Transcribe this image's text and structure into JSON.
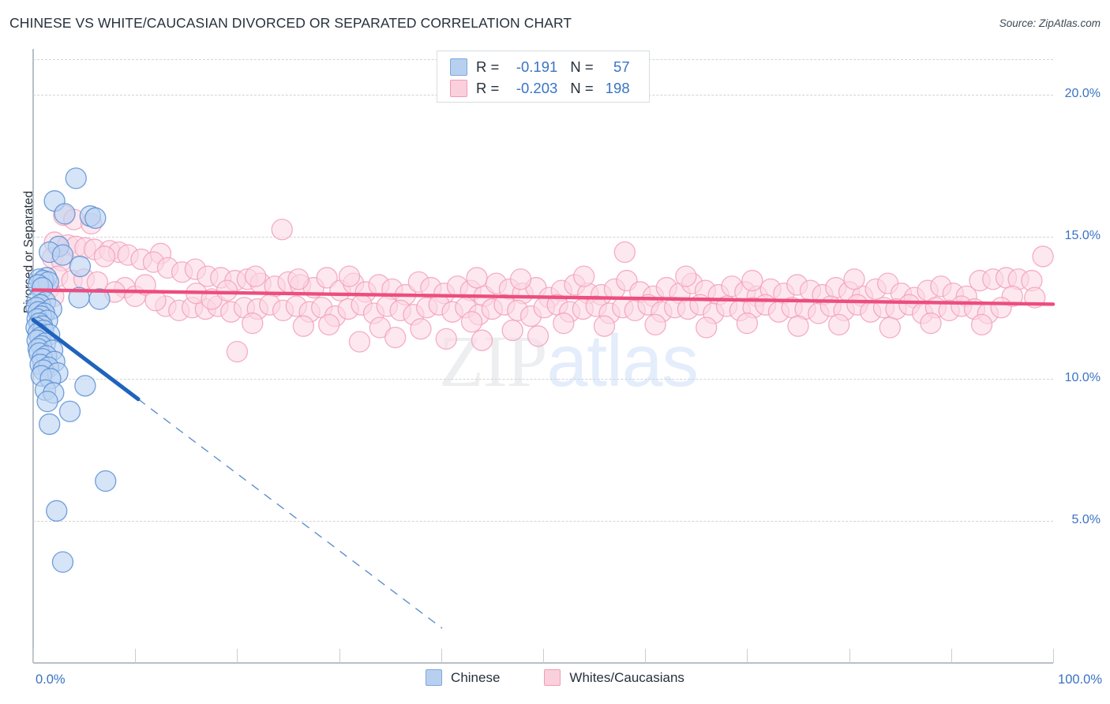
{
  "header": {
    "title": "CHINESE VS WHITE/CAUCASIAN DIVORCED OR SEPARATED CORRELATION CHART",
    "source": "Source: ZipAtlas.com"
  },
  "watermark": {
    "part1": "ZIP",
    "part2": "atlas"
  },
  "correlation_legend": {
    "rows": [
      {
        "color": "#b8d0ef",
        "r_label": "R = ",
        "r_value": "-0.191",
        "n_label": "N = ",
        "n_value": "57"
      },
      {
        "color": "#fbd0dd",
        "r_label": "R = ",
        "r_value": "-0.203",
        "n_label": "N = ",
        "n_value": "198"
      }
    ]
  },
  "series_legend": {
    "items": [
      {
        "label": "Chinese",
        "color": "#b8d0ef"
      },
      {
        "label": "Whites/Caucasians",
        "color": "#fbd0dd"
      }
    ]
  },
  "axes": {
    "y_title": "Divorced or Separated",
    "y_ticks": [
      "20.0%",
      "15.0%",
      "10.0%",
      "5.0%"
    ],
    "x_min_label": "0.0%",
    "x_max_label": "100.0%"
  },
  "colors": {
    "blue_fill": "#bcd4f2",
    "blue_stroke": "#5b8fd4",
    "pink_fill": "#fcd8e3",
    "pink_stroke": "#f3a0ba",
    "blue_trend": "#1f63bd",
    "pink_trend": "#ed4d7f",
    "tick_text": "#3973c4",
    "title_text": "#26313c"
  },
  "chart_data": {
    "type": "scatter",
    "title": "CHINESE VS WHITE/CAUCASIAN DIVORCED OR SEPARATED CORRELATION CHART",
    "xlabel": "",
    "ylabel": "Divorced or Separated",
    "xlim": [
      0,
      100
    ],
    "ylim": [
      0,
      21.6
    ],
    "x_tick_values": [
      0,
      10,
      20,
      30,
      40,
      50,
      60,
      70,
      80,
      90,
      100
    ],
    "y_tick_values": [
      5,
      10,
      15,
      20
    ],
    "y_tick_labels": [
      "5.0%",
      "10.0%",
      "15.0%",
      "20.0%"
    ],
    "x_axis_unit": "percent",
    "grid": "horizontal-dashed",
    "legend_position": "bottom-center",
    "series": [
      {
        "name": "Chinese",
        "color": "#bcd4f2",
        "R": -0.191,
        "N": 57,
        "trendline": {
          "type": "linear",
          "solid_from": [
            0.0,
            12.07
          ],
          "solid_to": [
            10.3,
            9.28
          ],
          "dashed_to": [
            40.1,
            1.22
          ]
        },
        "points": [
          [
            4.2,
            17.05
          ],
          [
            2.1,
            16.25
          ],
          [
            3.1,
            15.8
          ],
          [
            5.6,
            15.72
          ],
          [
            6.1,
            15.65
          ],
          [
            2.5,
            14.65
          ],
          [
            1.6,
            14.45
          ],
          [
            2.9,
            14.35
          ],
          [
            4.6,
            13.95
          ],
          [
            1.3,
            13.55
          ],
          [
            0.6,
            13.5
          ],
          [
            1.0,
            13.45
          ],
          [
            1.5,
            13.4
          ],
          [
            0.5,
            13.3
          ],
          [
            0.9,
            13.2
          ],
          [
            4.5,
            12.85
          ],
          [
            6.5,
            12.8
          ],
          [
            0.4,
            12.75
          ],
          [
            1.2,
            12.7
          ],
          [
            0.7,
            12.6
          ],
          [
            0.3,
            12.5
          ],
          [
            1.8,
            12.45
          ],
          [
            0.5,
            12.35
          ],
          [
            1.1,
            12.3
          ],
          [
            0.8,
            12.2
          ],
          [
            0.4,
            12.1
          ],
          [
            1.4,
            12.05
          ],
          [
            0.6,
            11.95
          ],
          [
            0.9,
            11.85
          ],
          [
            0.3,
            11.8
          ],
          [
            1.0,
            11.7
          ],
          [
            0.5,
            11.6
          ],
          [
            1.6,
            11.55
          ],
          [
            0.7,
            11.45
          ],
          [
            0.4,
            11.35
          ],
          [
            1.2,
            11.25
          ],
          [
            0.8,
            11.15
          ],
          [
            0.5,
            11.05
          ],
          [
            1.9,
            11.0
          ],
          [
            0.6,
            10.9
          ],
          [
            1.3,
            10.8
          ],
          [
            0.9,
            10.7
          ],
          [
            2.1,
            10.6
          ],
          [
            0.7,
            10.5
          ],
          [
            1.5,
            10.4
          ],
          [
            1.0,
            10.3
          ],
          [
            2.4,
            10.2
          ],
          [
            0.8,
            10.1
          ],
          [
            1.7,
            10.0
          ],
          [
            5.1,
            9.75
          ],
          [
            1.2,
            9.6
          ],
          [
            2.0,
            9.5
          ],
          [
            1.4,
            9.2
          ],
          [
            3.6,
            8.85
          ],
          [
            1.6,
            8.4
          ],
          [
            7.1,
            6.4
          ],
          [
            2.3,
            5.35
          ],
          [
            2.9,
            3.55
          ]
        ]
      },
      {
        "name": "Whites/Caucasians",
        "color": "#fcd8e3",
        "R": -0.203,
        "N": 198,
        "trendline": {
          "type": "linear",
          "from": [
            0.0,
            13.12
          ],
          "to": [
            100.0,
            12.62
          ]
        },
        "points": [
          [
            3.0,
            15.75
          ],
          [
            4.0,
            15.6
          ],
          [
            5.7,
            15.45
          ],
          [
            2.1,
            14.8
          ],
          [
            3.4,
            14.7
          ],
          [
            4.2,
            14.65
          ],
          [
            5.1,
            14.6
          ],
          [
            6.0,
            14.55
          ],
          [
            7.5,
            14.5
          ],
          [
            8.4,
            14.45
          ],
          [
            1.9,
            14.25
          ],
          [
            2.8,
            14.15
          ],
          [
            12.5,
            14.4
          ],
          [
            7.0,
            14.3
          ],
          [
            9.3,
            14.35
          ],
          [
            10.6,
            14.2
          ],
          [
            11.8,
            14.1
          ],
          [
            24.4,
            15.25
          ],
          [
            13.2,
            13.9
          ],
          [
            14.6,
            13.75
          ],
          [
            15.9,
            13.85
          ],
          [
            17.1,
            13.6
          ],
          [
            18.4,
            13.55
          ],
          [
            19.8,
            13.45
          ],
          [
            21.0,
            13.5
          ],
          [
            22.3,
            13.35
          ],
          [
            23.7,
            13.25
          ],
          [
            25.0,
            13.4
          ],
          [
            26.2,
            13.3
          ],
          [
            27.5,
            13.2
          ],
          [
            28.8,
            13.55
          ],
          [
            30.1,
            13.1
          ],
          [
            31.4,
            13.35
          ],
          [
            32.6,
            13.05
          ],
          [
            33.9,
            13.3
          ],
          [
            35.2,
            13.15
          ],
          [
            36.5,
            12.95
          ],
          [
            37.8,
            13.4
          ],
          [
            39.0,
            13.2
          ],
          [
            40.3,
            13.0
          ],
          [
            41.6,
            13.25
          ],
          [
            42.9,
            13.1
          ],
          [
            44.2,
            12.9
          ],
          [
            45.4,
            13.35
          ],
          [
            46.7,
            13.15
          ],
          [
            48.0,
            13.0
          ],
          [
            49.3,
            13.2
          ],
          [
            50.6,
            12.85
          ],
          [
            51.8,
            13.1
          ],
          [
            53.1,
            13.3
          ],
          [
            54.4,
            13.0
          ],
          [
            55.7,
            12.95
          ],
          [
            57.0,
            13.15
          ],
          [
            58.2,
            13.45
          ],
          [
            59.5,
            13.05
          ],
          [
            60.8,
            12.9
          ],
          [
            62.1,
            13.2
          ],
          [
            63.4,
            13.0
          ],
          [
            64.6,
            13.35
          ],
          [
            65.9,
            13.1
          ],
          [
            67.2,
            12.95
          ],
          [
            68.5,
            13.25
          ],
          [
            69.8,
            13.05
          ],
          [
            71.0,
            12.9
          ],
          [
            72.3,
            13.15
          ],
          [
            73.6,
            13.0
          ],
          [
            74.9,
            13.3
          ],
          [
            76.2,
            13.1
          ],
          [
            77.4,
            12.95
          ],
          [
            78.7,
            13.2
          ],
          [
            80.0,
            13.05
          ],
          [
            81.3,
            12.9
          ],
          [
            82.6,
            13.15
          ],
          [
            83.8,
            13.35
          ],
          [
            85.1,
            13.0
          ],
          [
            86.4,
            12.85
          ],
          [
            87.7,
            13.1
          ],
          [
            89.0,
            13.25
          ],
          [
            90.2,
            13.0
          ],
          [
            91.5,
            12.9
          ],
          [
            92.8,
            13.45
          ],
          [
            94.1,
            13.5
          ],
          [
            95.4,
            13.55
          ],
          [
            96.6,
            13.5
          ],
          [
            97.9,
            13.45
          ],
          [
            99.0,
            14.3
          ],
          [
            98.2,
            12.85
          ],
          [
            96.0,
            12.9
          ],
          [
            13.0,
            12.55
          ],
          [
            14.3,
            12.4
          ],
          [
            15.6,
            12.5
          ],
          [
            16.9,
            12.45
          ],
          [
            18.1,
            12.55
          ],
          [
            19.4,
            12.35
          ],
          [
            20.7,
            12.5
          ],
          [
            22.0,
            12.45
          ],
          [
            23.2,
            12.6
          ],
          [
            24.5,
            12.4
          ],
          [
            25.8,
            12.55
          ],
          [
            27.1,
            12.35
          ],
          [
            28.3,
            12.5
          ],
          [
            29.6,
            12.2
          ],
          [
            30.9,
            12.45
          ],
          [
            32.2,
            12.6
          ],
          [
            33.4,
            12.3
          ],
          [
            34.7,
            12.55
          ],
          [
            36.0,
            12.4
          ],
          [
            37.3,
            12.25
          ],
          [
            38.6,
            12.5
          ],
          [
            39.8,
            12.6
          ],
          [
            41.1,
            12.35
          ],
          [
            42.4,
            12.5
          ],
          [
            43.7,
            12.25
          ],
          [
            45.0,
            12.45
          ],
          [
            46.2,
            12.6
          ],
          [
            47.5,
            12.4
          ],
          [
            48.8,
            12.2
          ],
          [
            50.1,
            12.5
          ],
          [
            51.4,
            12.6
          ],
          [
            52.6,
            12.35
          ],
          [
            53.9,
            12.45
          ],
          [
            55.2,
            12.55
          ],
          [
            56.5,
            12.3
          ],
          [
            57.8,
            12.5
          ],
          [
            59.0,
            12.4
          ],
          [
            60.3,
            12.6
          ],
          [
            61.6,
            12.35
          ],
          [
            62.9,
            12.5
          ],
          [
            64.2,
            12.45
          ],
          [
            65.4,
            12.6
          ],
          [
            66.7,
            12.3
          ],
          [
            68.0,
            12.55
          ],
          [
            69.3,
            12.4
          ],
          [
            70.6,
            12.5
          ],
          [
            71.8,
            12.6
          ],
          [
            73.1,
            12.35
          ],
          [
            74.4,
            12.5
          ],
          [
            75.7,
            12.45
          ],
          [
            77.0,
            12.3
          ],
          [
            78.2,
            12.55
          ],
          [
            79.5,
            12.4
          ],
          [
            80.8,
            12.6
          ],
          [
            82.1,
            12.35
          ],
          [
            83.4,
            12.5
          ],
          [
            84.6,
            12.45
          ],
          [
            85.9,
            12.6
          ],
          [
            87.2,
            12.3
          ],
          [
            88.5,
            12.5
          ],
          [
            89.8,
            12.4
          ],
          [
            91.0,
            12.55
          ],
          [
            92.3,
            12.45
          ],
          [
            93.6,
            12.3
          ],
          [
            94.9,
            12.5
          ],
          [
            21.5,
            11.95
          ],
          [
            26.5,
            11.85
          ],
          [
            29.0,
            11.9
          ],
          [
            34.0,
            11.8
          ],
          [
            38.0,
            11.75
          ],
          [
            43.0,
            12.0
          ],
          [
            47.0,
            11.7
          ],
          [
            52.0,
            11.95
          ],
          [
            56.0,
            11.85
          ],
          [
            61.0,
            11.9
          ],
          [
            66.0,
            11.8
          ],
          [
            70.0,
            11.95
          ],
          [
            75.0,
            11.85
          ],
          [
            79.0,
            11.9
          ],
          [
            84.0,
            11.8
          ],
          [
            88.0,
            11.95
          ],
          [
            93.0,
            11.9
          ],
          [
            20.0,
            10.95
          ],
          [
            32.0,
            11.3
          ],
          [
            44.0,
            11.35
          ],
          [
            35.5,
            11.45
          ],
          [
            40.5,
            11.4
          ],
          [
            49.5,
            11.5
          ],
          [
            2.4,
            13.6
          ],
          [
            3.8,
            13.45
          ],
          [
            5.0,
            13.5
          ],
          [
            6.3,
            13.4
          ],
          [
            1.5,
            13.15
          ],
          [
            2.0,
            12.9
          ],
          [
            16.0,
            13.0
          ],
          [
            17.5,
            12.8
          ],
          [
            19.0,
            13.1
          ],
          [
            9.0,
            13.2
          ],
          [
            10.0,
            12.9
          ],
          [
            11.0,
            13.3
          ],
          [
            8.0,
            13.05
          ],
          [
            12.0,
            12.75
          ],
          [
            58.0,
            14.45
          ],
          [
            54.0,
            13.6
          ],
          [
            64.0,
            13.6
          ],
          [
            80.5,
            13.5
          ],
          [
            70.5,
            13.45
          ],
          [
            47.8,
            13.5
          ],
          [
            43.5,
            13.55
          ],
          [
            31.0,
            13.6
          ],
          [
            26.0,
            13.5
          ],
          [
            21.8,
            13.6
          ]
        ]
      }
    ]
  }
}
